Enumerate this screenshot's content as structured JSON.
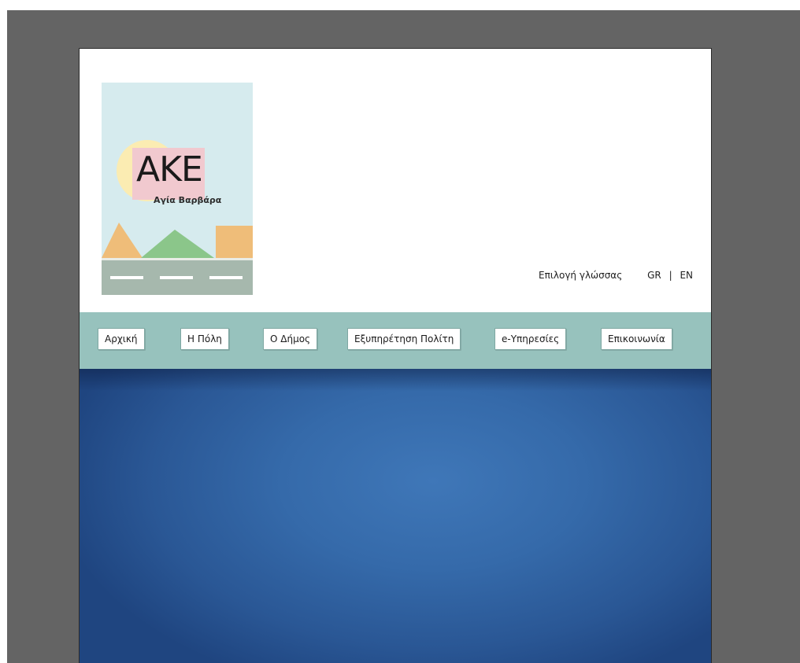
{
  "logo": {
    "title": "AKE",
    "subtitle": "Αγία Βαρβάρα"
  },
  "language": {
    "label": "Επιλογή γλώσσας",
    "options": [
      "GR",
      "EN"
    ],
    "separator": "|"
  },
  "nav": {
    "items": [
      {
        "label": "Αρχική"
      },
      {
        "label": "Η Πόλη"
      },
      {
        "label": "Ο Δήμος"
      },
      {
        "label": "Εξυπηρέτηση Πολίτη"
      },
      {
        "label": "e-Υπηρεσίες"
      },
      {
        "label": "Επικοινωνία"
      }
    ]
  },
  "colors": {
    "workspace": "#646464",
    "logo_bg": "#d6ebee",
    "logo_sun": "#fbecb2",
    "logo_textbox": "#f1c9cf",
    "mountain_orange": "#efbd79",
    "mountain_green": "#8bc68a",
    "road": "#a6b8ad",
    "navbar": "#97c2bd",
    "hero": "#356aaa"
  }
}
